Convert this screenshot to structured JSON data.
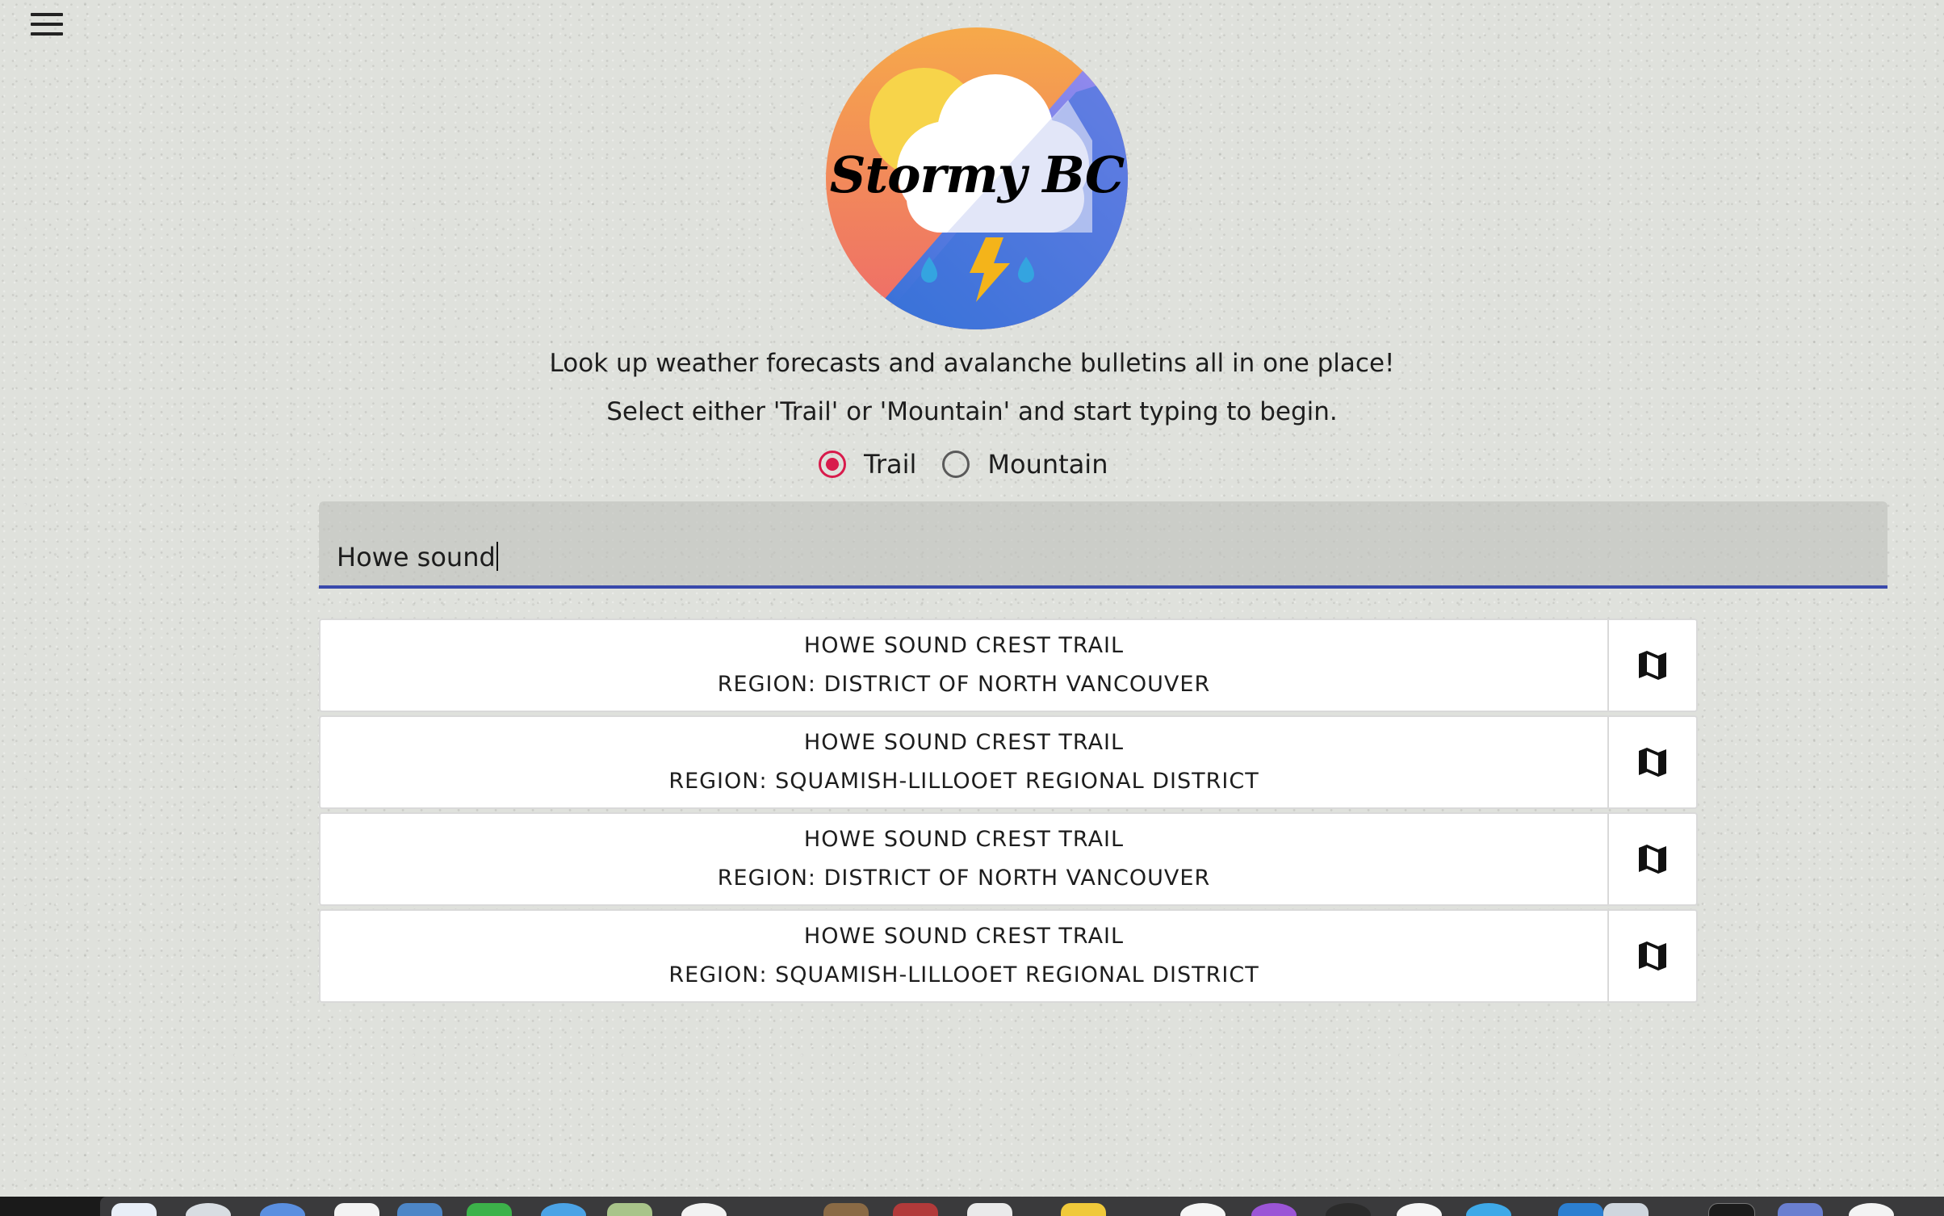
{
  "header": {
    "menu_icon": "hamburger-menu-icon"
  },
  "logo": {
    "text": "Stormy BC",
    "icon": "storm-cloud-lightning-icon"
  },
  "intro": {
    "line1": "Look up weather forecasts and avalanche bulletins all in one place!",
    "line2": "Select either 'Trail' or 'Mountain' and start typing to begin."
  },
  "search_type": {
    "options": [
      {
        "label": "Trail",
        "checked": true
      },
      {
        "label": "Mountain",
        "checked": false
      }
    ],
    "accent_color": "#d81b4c"
  },
  "search": {
    "value": "Howe sound",
    "underline_color": "#3949ab"
  },
  "results": [
    {
      "title": "HOWE SOUND CREST TRAIL",
      "region": "REGION: DISTRICT OF NORTH VANCOUVER",
      "action_icon": "map-icon"
    },
    {
      "title": "HOWE SOUND CREST TRAIL",
      "region": "REGION: SQUAMISH-LILLOOET REGIONAL DISTRICT",
      "action_icon": "map-icon"
    },
    {
      "title": "HOWE SOUND CREST TRAIL",
      "region": "REGION: DISTRICT OF NORTH VANCOUVER",
      "action_icon": "map-icon"
    },
    {
      "title": "HOWE SOUND CREST TRAIL",
      "region": "REGION: SQUAMISH-LILLOOET REGIONAL DISTRICT",
      "action_icon": "map-icon"
    }
  ]
}
